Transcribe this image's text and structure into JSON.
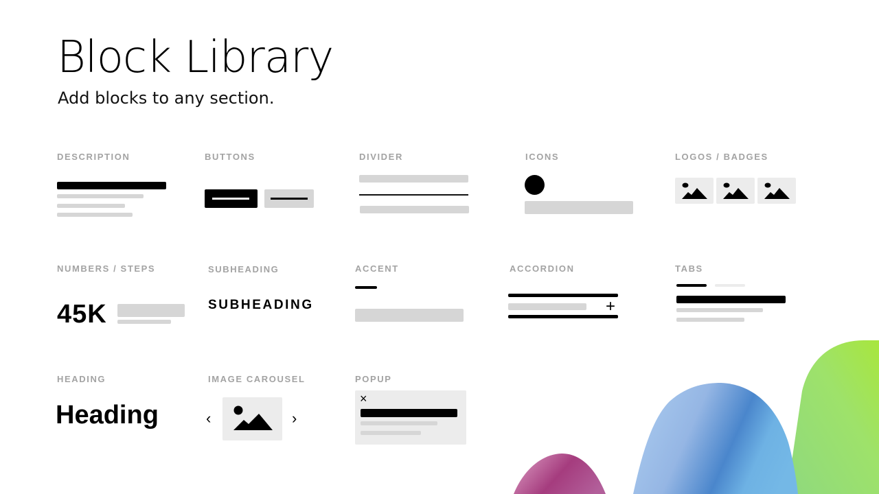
{
  "header": {
    "title": "Block Library",
    "subtitle": "Add blocks to any section."
  },
  "blocks": {
    "description": {
      "label": "DESCRIPTION"
    },
    "buttons": {
      "label": "BUTTONS"
    },
    "divider": {
      "label": "DIVIDER"
    },
    "icons": {
      "label": "ICONS"
    },
    "logos_badges": {
      "label": "LOGOS / BADGES"
    },
    "numbers_steps": {
      "label": "NUMBERS / STEPS",
      "value": "45K"
    },
    "subheading": {
      "label": "SUBHEADING",
      "sample": "SUBHEADING"
    },
    "accent": {
      "label": "ACCENT"
    },
    "accordion": {
      "label": "ACCORDION",
      "expand_icon": "+"
    },
    "tabs": {
      "label": "TABS"
    },
    "heading": {
      "label": "HEADING",
      "sample": "Heading"
    },
    "image_carousel": {
      "label": "IMAGE CAROUSEL",
      "prev_icon": "‹",
      "next_icon": "›"
    },
    "popup": {
      "label": "POPUP",
      "close_icon": "×"
    }
  },
  "colors": {
    "placeholder_dark": "#000000",
    "placeholder_gray": "#d6d6d6",
    "placeholder_light": "#ececec",
    "label_gray": "#a3a3a3",
    "blob_pink": "#a83c7e",
    "blob_blue": "#4a8ad0",
    "blob_green": "#9de24f"
  }
}
